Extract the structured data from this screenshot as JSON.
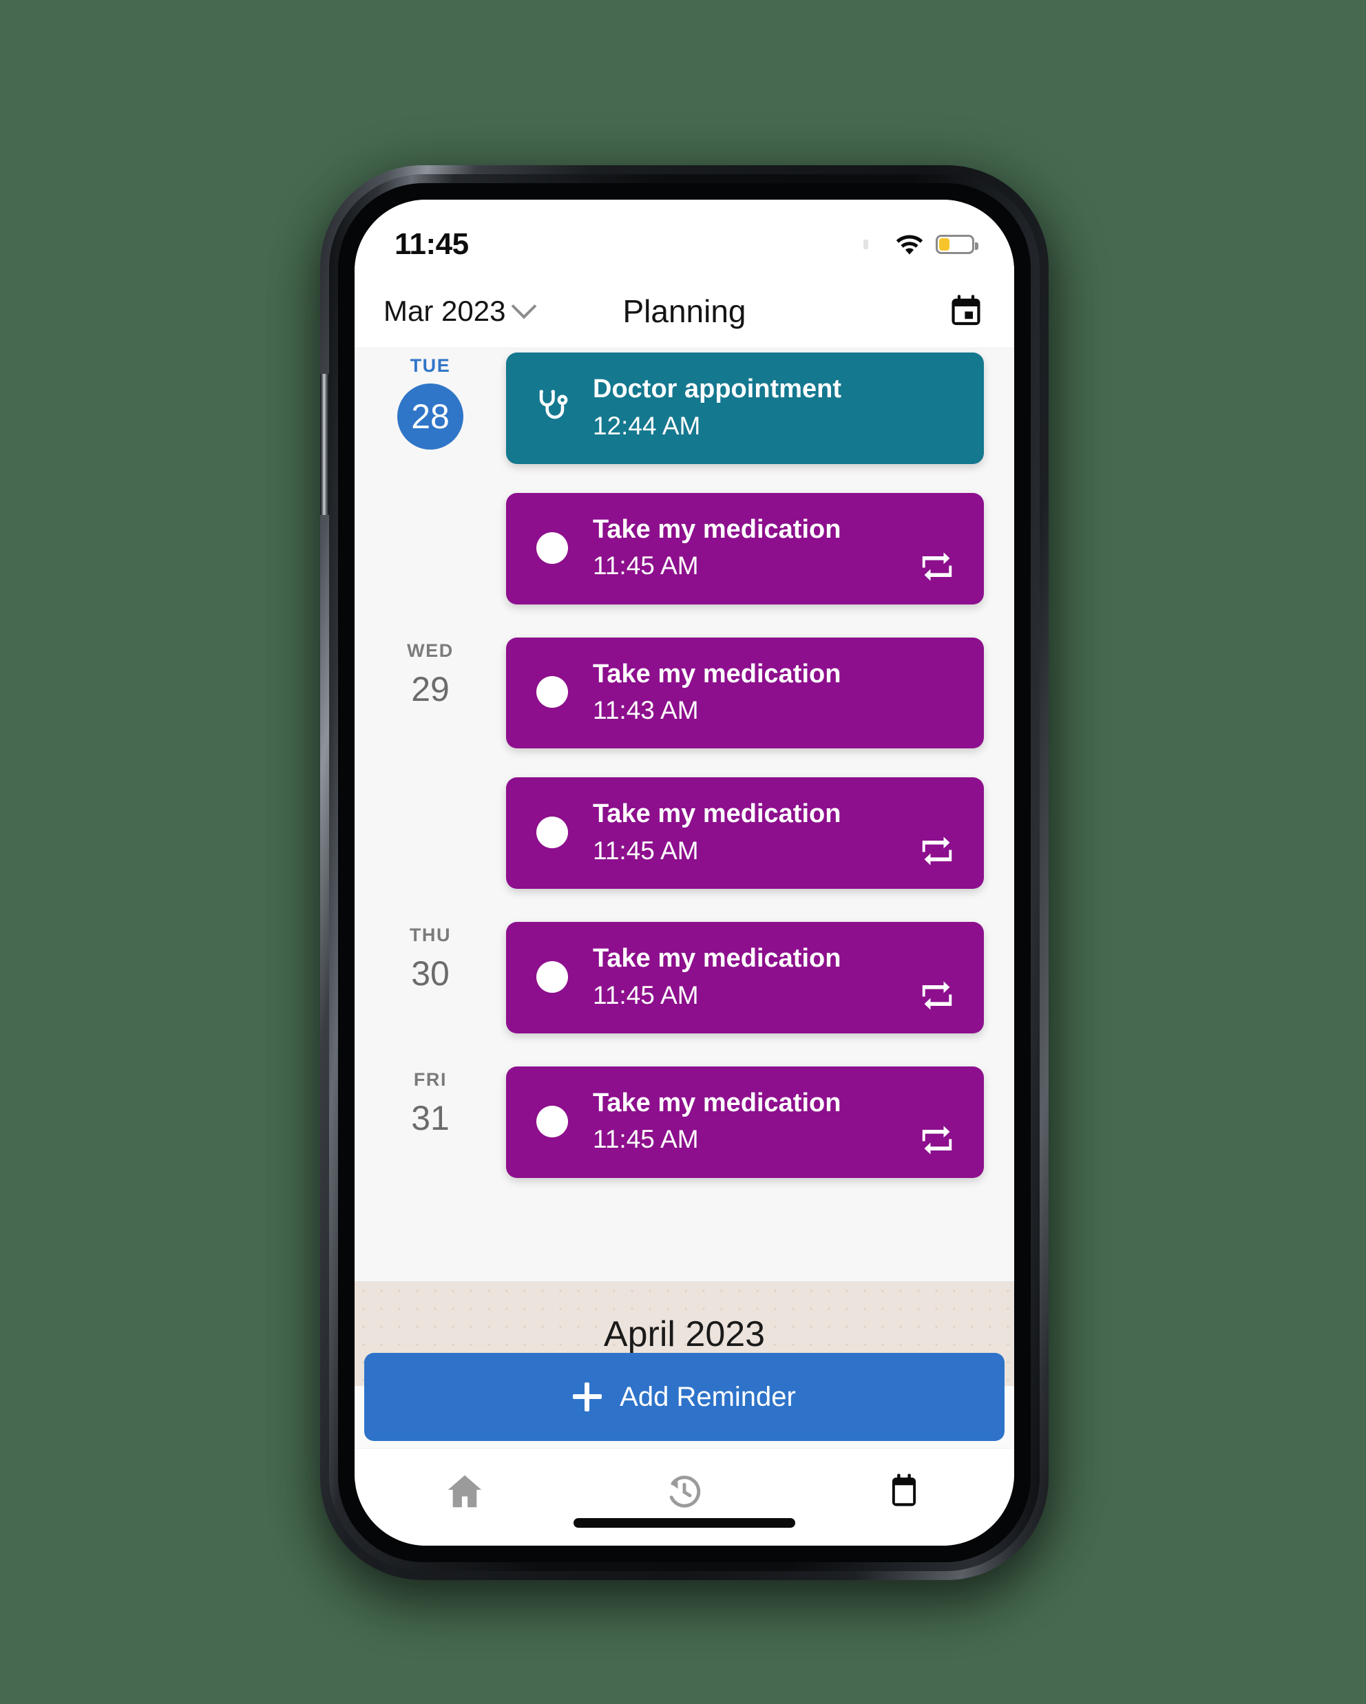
{
  "status_bar": {
    "time": "11:45",
    "wifi_icon": "wifi-icon",
    "battery_icon": "battery-low-icon",
    "battery_level_percent": 30,
    "battery_color": "#f7c52b"
  },
  "app_bar": {
    "month_selector": "Mar 2023",
    "chevron_icon": "chevron-down-icon",
    "title": "Planning",
    "calendar_icon": "calendar-today-icon"
  },
  "theme": {
    "accent_blue": "#3076c8",
    "appointment_teal": "#14788f",
    "medication_purple": "#8d0f8d",
    "add_button_blue": "#2e73c9",
    "month_banner_beige": "#ece3dc",
    "page_background": "#f7f7f7"
  },
  "days": [
    {
      "dow": "TUE",
      "date": "28",
      "is_today": true,
      "events": [
        {
          "title": "Doctor appointment",
          "time": "12:44 AM",
          "color": "teal",
          "icon": "stethoscope-icon",
          "repeating": false
        },
        {
          "title": "Take my medication",
          "time": "11:45 AM",
          "color": "purple",
          "icon": "pill-bullet-icon",
          "repeating": true
        }
      ]
    },
    {
      "dow": "WED",
      "date": "29",
      "is_today": false,
      "events": [
        {
          "title": "Take my medication",
          "time": "11:43 AM",
          "color": "purple",
          "icon": "pill-bullet-icon",
          "repeating": false
        },
        {
          "title": "Take my medication",
          "time": "11:45 AM",
          "color": "purple",
          "icon": "pill-bullet-icon",
          "repeating": true
        }
      ]
    },
    {
      "dow": "THU",
      "date": "30",
      "is_today": false,
      "events": [
        {
          "title": "Take my medication",
          "time": "11:45 AM",
          "color": "purple",
          "icon": "pill-bullet-icon",
          "repeating": true
        }
      ]
    },
    {
      "dow": "FRI",
      "date": "31",
      "is_today": false,
      "events": [
        {
          "title": "Take my medication",
          "time": "11:45 AM",
          "color": "purple",
          "icon": "pill-bullet-icon",
          "repeating": true
        }
      ]
    }
  ],
  "month_banner": {
    "label": "April 2023"
  },
  "add_reminder": {
    "label": "Add Reminder",
    "plus_icon": "plus-icon"
  },
  "bottom_nav": {
    "items": [
      {
        "name": "home",
        "icon": "home-icon",
        "active": false
      },
      {
        "name": "history",
        "icon": "history-clock-icon",
        "active": false
      },
      {
        "name": "planning",
        "icon": "calendar-icon",
        "active": true
      }
    ]
  }
}
